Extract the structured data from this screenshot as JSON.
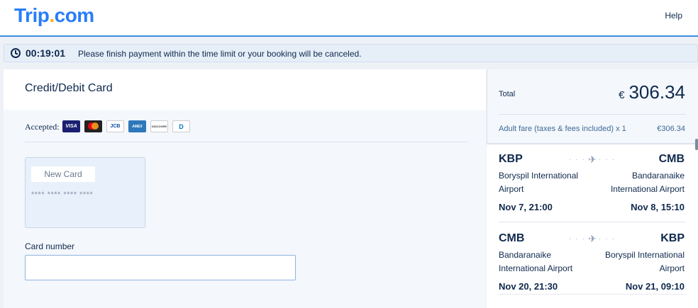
{
  "header": {
    "logo": "Trip",
    "logo_dot": ".",
    "logo_tld": "com",
    "help": "Help"
  },
  "timer": {
    "time": "00:19:01",
    "message": "Please finish payment within the time limit or your booking will be canceled."
  },
  "payment": {
    "title": "Credit/Debit Card",
    "accepted_label": "Accepted:",
    "cards": [
      {
        "name": "visa-icon",
        "text": "VISA"
      },
      {
        "name": "mastercard-icon",
        "text": ""
      },
      {
        "name": "jcb-icon",
        "text": "JCB"
      },
      {
        "name": "amex-icon",
        "text": "AMEX"
      },
      {
        "name": "discover-icon",
        "text": "DISCOVER"
      },
      {
        "name": "diners-club-icon",
        "text": "D"
      }
    ],
    "new_card_label": "New Card",
    "new_card_mask": "**** **** **** ****",
    "card_number_label": "Card number",
    "card_number_value": "",
    "card_number_placeholder": ""
  },
  "summary": {
    "total_label": "Total",
    "currency": "€",
    "total_amount": "306.34",
    "fare_label": "Adult fare (taxes & fees included) x 1",
    "fare_value": "€306.34",
    "segments": [
      {
        "from_code": "KBP",
        "to_code": "CMB",
        "from_airport": "Boryspil International Airport",
        "to_airport": "Bandaranaike International Airport",
        "depart": "Nov 7, 21:00",
        "arrive": "Nov 8, 15:10"
      },
      {
        "from_code": "CMB",
        "to_code": "KBP",
        "from_airport": "Bandaranaike International Airport",
        "to_airport": "Boryspil International Airport",
        "depart": "Nov 20, 21:30",
        "arrive": "Nov 21, 09:10"
      }
    ]
  }
}
